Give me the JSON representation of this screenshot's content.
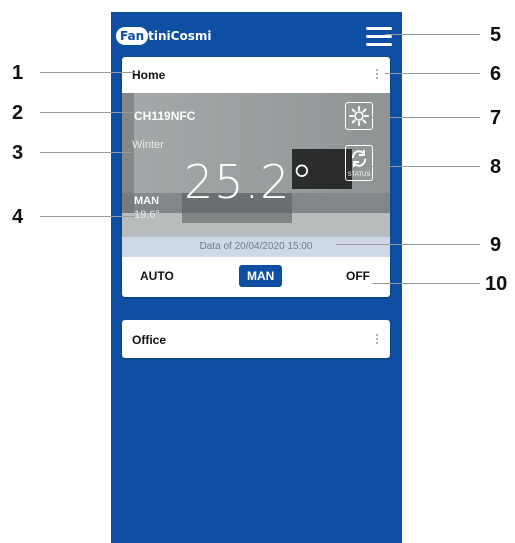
{
  "app": {
    "logo_prefix": "Fan",
    "logo_text": "tiniCosmi"
  },
  "home_card": {
    "title": "Home",
    "device_name": "CH119NFC",
    "season": "Winter",
    "temperature": "25.2°",
    "mode_label": "MAN",
    "setpoint": "19.6°",
    "status_label": "STATUS",
    "date_text": "Data of 20/04/2020 15:00",
    "modes": [
      "AUTO",
      "MAN",
      "OFF"
    ],
    "selected_mode": "MAN"
  },
  "office_card": {
    "title": "Office"
  },
  "callouts": [
    "1",
    "2",
    "3",
    "4",
    "5",
    "6",
    "7",
    "8",
    "9",
    "10"
  ],
  "colors": {
    "brand_blue": "#0f4fa3",
    "date_bar": "#cfd8e6"
  }
}
